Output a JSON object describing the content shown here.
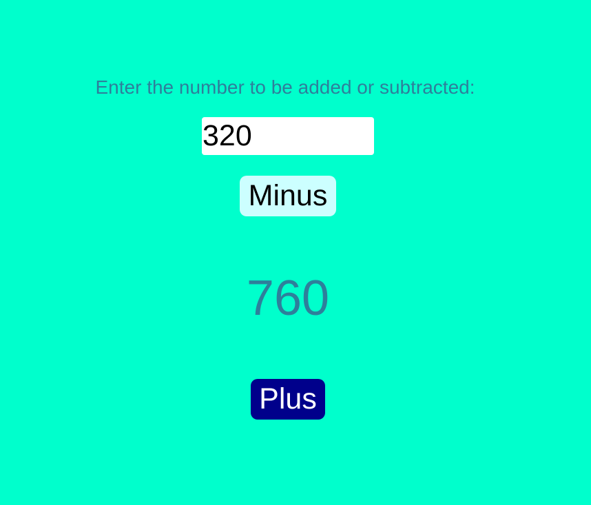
{
  "prompt": {
    "text": "Enter the number to be added or subtracted:"
  },
  "input": {
    "value": "320"
  },
  "buttons": {
    "minus_label": "Minus",
    "plus_label": "Plus"
  },
  "result": {
    "value": "760"
  },
  "colors": {
    "background": "#00ffcc",
    "text": "#2e7f9b",
    "minus_button": "#ccffff",
    "plus_button": "#00008b"
  }
}
